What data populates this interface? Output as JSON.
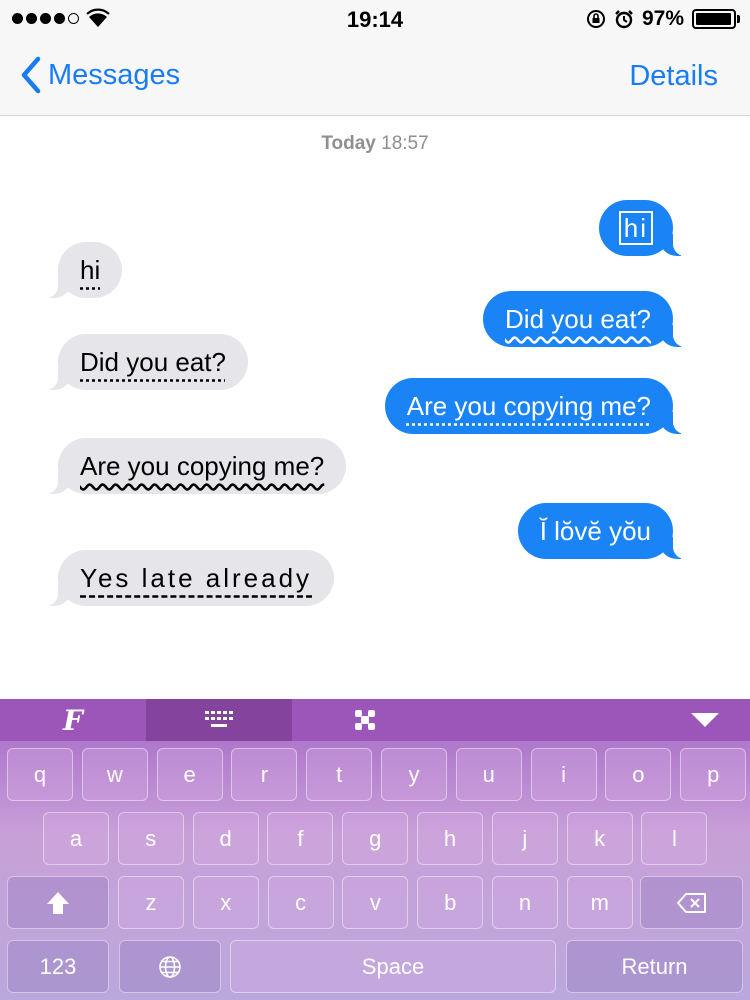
{
  "status_bar": {
    "time": "19:14",
    "battery_percent": "97%",
    "battery_level": 0.97,
    "signal_bars_filled": 4,
    "signal_bars_total": 5,
    "icons": [
      "wifi-icon",
      "orientation-lock-icon",
      "alarm-icon",
      "battery-icon"
    ]
  },
  "nav": {
    "back_label": "Messages",
    "details_label": "Details"
  },
  "conversation": {
    "timestamp_day": "Today",
    "timestamp_time": "18:57",
    "messages": [
      {
        "from": "me",
        "text": "hi"
      },
      {
        "from": "them",
        "text": "hi"
      },
      {
        "from": "me",
        "text": "Did you eat?"
      },
      {
        "from": "them",
        "text": "Did you eat?"
      },
      {
        "from": "me",
        "text": "Are you copying me?"
      },
      {
        "from": "them",
        "text": "Are you copying me?"
      },
      {
        "from": "me",
        "text": "Ĭ lŏvĕ yŏu"
      },
      {
        "from": "them",
        "text": "Yes late already"
      }
    ]
  },
  "keyboard": {
    "toolbar": {
      "fonts_glyph": "F",
      "icons": [
        "fonts-icon",
        "keyboard-icon",
        "emoji-icon",
        "dismiss-keyboard-icon"
      ]
    },
    "row1": [
      "q",
      "w",
      "e",
      "r",
      "t",
      "y",
      "u",
      "i",
      "o",
      "p"
    ],
    "row2": [
      "a",
      "s",
      "d",
      "f",
      "g",
      "h",
      "j",
      "k",
      "l"
    ],
    "row3": [
      "z",
      "x",
      "c",
      "v",
      "b",
      "n",
      "m"
    ],
    "numbers_label": "123",
    "space_label": "Space",
    "return_label": "Return"
  },
  "colors": {
    "accent": "#1a7cf5",
    "outgoing_bubble": "#1a84f7",
    "incoming_bubble": "#e5e5ea",
    "keyboard_top": "#a465c6",
    "keyboard_bottom": "#b9a8dc"
  }
}
